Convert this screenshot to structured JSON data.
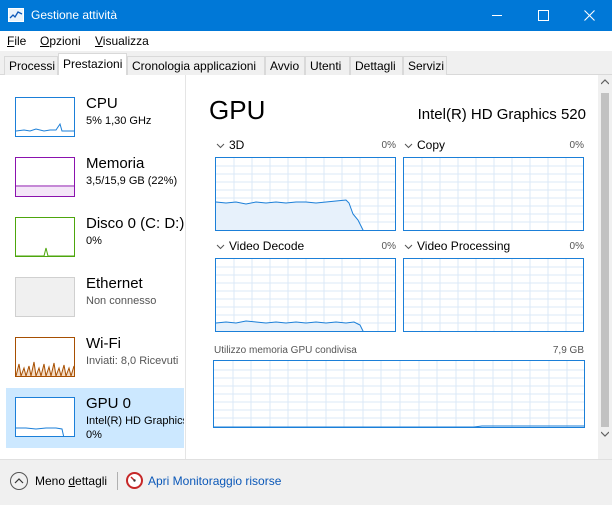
{
  "window": {
    "title": "Gestione attività",
    "minimize_icon": "minimize-icon",
    "maximize_icon": "maximize-icon",
    "close_icon": "close-icon"
  },
  "menu": [
    {
      "label": "File",
      "accel": "F",
      "rest": "ile"
    },
    {
      "label": "Opzioni",
      "accel": "O",
      "rest": "pzioni"
    },
    {
      "label": "Visualizza",
      "accel": "V",
      "rest": "isualizza"
    }
  ],
  "tabs": [
    "Processi",
    "Prestazioni",
    "Cronologia applicazioni",
    "Avvio",
    "Utenti",
    "Dettagli",
    "Servizi"
  ],
  "active_tab": "Prestazioni",
  "sidebar": [
    {
      "title": "CPU",
      "sub": "5%  1,30 GHz",
      "sub2": "",
      "color": "#1b7fd8"
    },
    {
      "title": "Memoria",
      "sub": "3,5/15,9 GB (22%)",
      "sub2": "",
      "color": "#8b12ae"
    },
    {
      "title": "Disco 0 (C: D:)",
      "sub": "0%",
      "sub2": "",
      "color": "#4da60c"
    },
    {
      "title": "Ethernet",
      "sub": "Non connesso",
      "sub2": "",
      "color": "#a0a0a0"
    },
    {
      "title": "Wi-Fi",
      "sub": "Inviati: 8,0 Ricevuti",
      "sub2": "",
      "color": "#a74f01"
    },
    {
      "title": "GPU 0",
      "sub": "Intel(R) HD Graphics",
      "sub2": "0%",
      "color": "#1b7fd8"
    }
  ],
  "selected_sidebar": "GPU 0",
  "main": {
    "title": "GPU",
    "model": "Intel(R) HD Graphics 520",
    "engines": [
      {
        "label": "3D",
        "percent": "0%"
      },
      {
        "label": "Copy",
        "percent": "0%"
      },
      {
        "label": "Video Decode",
        "percent": "0%"
      },
      {
        "label": "Video Processing",
        "percent": "0%"
      }
    ],
    "shared_memory_label": "Utilizzo memoria GPU condivisa",
    "shared_memory_value": "7,9 GB"
  },
  "footer": {
    "fewer_details": "Meno dettagli",
    "fewer_accel": "d",
    "resource_monitor": "Apri Monitoraggio risorse"
  },
  "colors": {
    "titlebar": "#0078d7",
    "accent": "#1b7fd8",
    "selected": "#cce8ff",
    "link": "#0b58b8"
  }
}
